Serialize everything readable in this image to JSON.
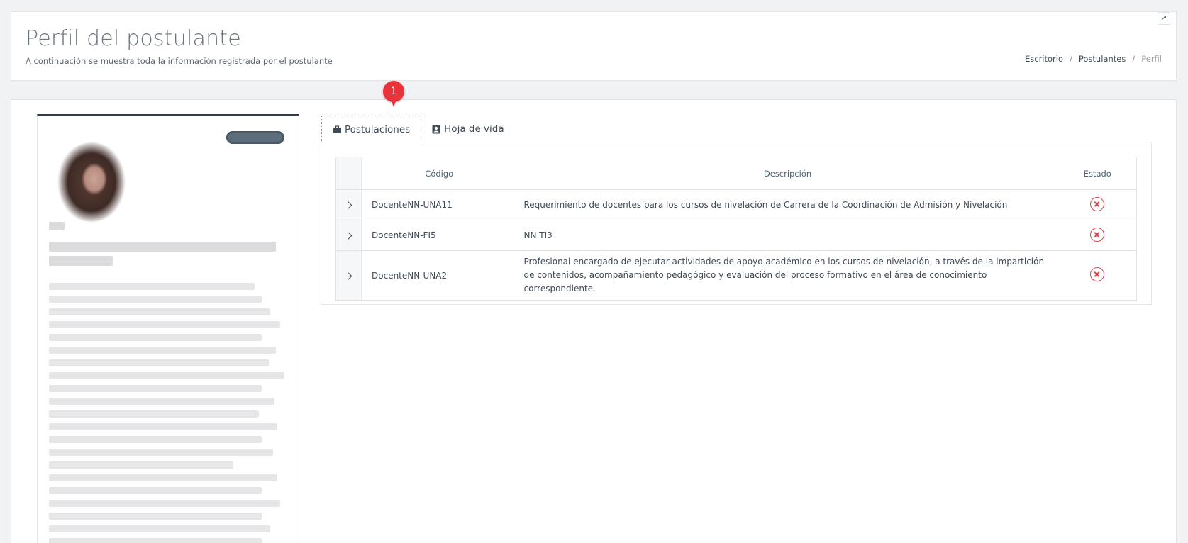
{
  "header": {
    "title": "Perfil del postulante",
    "subtitle": "A continuación se muestra toda la información registrada por el postulante",
    "breadcrumb": [
      {
        "label": "Escritorio"
      },
      {
        "label": "Postulantes"
      },
      {
        "label": "Perfil"
      }
    ],
    "corner_icon": "expand-icon"
  },
  "tabs": [
    {
      "label": "Postulaciones",
      "icon": "briefcase-icon",
      "active": true
    },
    {
      "label": "Hoja de vida",
      "icon": "id-card-icon",
      "active": false
    }
  ],
  "marker": {
    "label": "1"
  },
  "table": {
    "columns": [
      "Código",
      "Descripción",
      "Estado"
    ],
    "rows": [
      {
        "code": "DocenteNN-UNA11",
        "description": "Requerimiento de docentes para los cursos de nivelación de Carrera de la Coordinación de Admisión y Nivelación",
        "status_icon": "x-circle-icon"
      },
      {
        "code": "DocenteNN-FI5",
        "description": "NN TI3",
        "status_icon": "x-circle-icon"
      },
      {
        "code": "DocenteNN-UNA2",
        "description": "Profesional encargado de ejecutar actividades de apoyo académico en los cursos de nivelación, a través de la impartición de contenidos, acompañamiento pedagógico y evaluación del proceso formativo en el área de conocimiento correspondiente.",
        "status_icon": "x-circle-icon"
      }
    ]
  },
  "colors": {
    "accent_dark": "#2d3e50",
    "danger": "#e0464d",
    "marker": "#e8333a"
  }
}
